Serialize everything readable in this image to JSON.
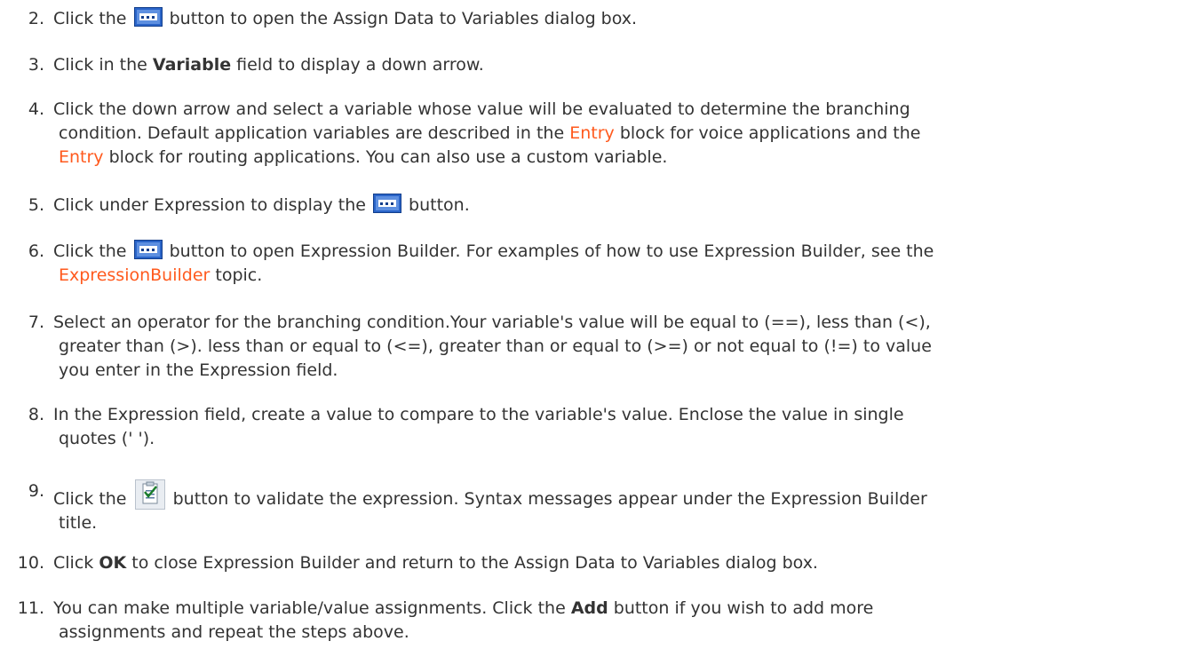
{
  "steps": [
    {
      "n": "2.",
      "a": "Click the ",
      "b": " button to open the Assign Data to Variables dialog box."
    },
    {
      "n": "3.",
      "a": "Click in the ",
      "bold": "Variable",
      "b": " field to display a down arrow."
    },
    {
      "n": "4.",
      "a": "Click the down arrow and select a variable whose value will be evaluated to determine the branching",
      "l2a": "condition. Default application variables are described in the ",
      "link1": "Entry",
      "l2b": " block for voice applications and the",
      "link2": "Entry",
      "l3b": " block for routing applications. You can also use a custom variable."
    },
    {
      "n": "5.",
      "a": "Click under Expression to display the ",
      "b": " button."
    },
    {
      "n": "6.",
      "a": "Click the ",
      "b": " button to open Expression Builder. For examples of how to use Expression Builder, see the",
      "link": "ExpressionBuilder",
      "c": " topic."
    },
    {
      "n": "7.",
      "l1": "Select an operator for the branching condition.Your variable's value will be equal to (==), less than (<),",
      "l2": "greater than (>). less than or equal to (<=), greater than or equal to (>=) or not equal to (!=) to value",
      "l3": "you enter in the Expression field."
    },
    {
      "n": "8.",
      "l1": "In the Expression field, create a value to compare to the variable's value. Enclose the value in single",
      "l2": "quotes ('  ')."
    },
    {
      "n": "9.",
      "a": "Click the ",
      "b": " button to validate the expression. Syntax messages appear under the Expression Builder",
      "l2": "title."
    },
    {
      "n": "10.",
      "a": "Click ",
      "bold": "OK",
      "b": " to close Expression Builder and return to the Assign Data to Variables dialog box."
    },
    {
      "n": "11.",
      "a": "You can make multiple variable/value assignments. Click the ",
      "bold": "Add",
      "b": " button if you wish to add more",
      "l2": "assignments and repeat the steps above."
    }
  ],
  "colors": {
    "text": "#333333",
    "link": "#ff5a1e",
    "icon_blue": "#2a64c8"
  },
  "icons": {
    "ellipsis_button": "ellipsis-button-icon",
    "validate_button": "validate-checklist-icon"
  }
}
